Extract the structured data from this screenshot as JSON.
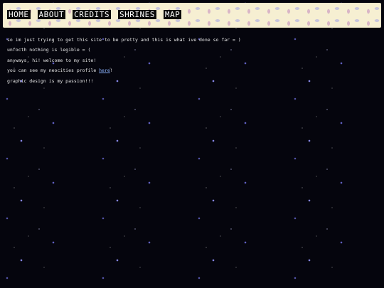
{
  "nav": {
    "items": [
      {
        "label": "HOME"
      },
      {
        "label": "ABOUT"
      },
      {
        "label": "CREDITS"
      },
      {
        "label": "SHRINES"
      },
      {
        "label": "MAP"
      }
    ]
  },
  "content": {
    "line1": "so im just trying to get this site to be pretty and this is what ive done so far = )",
    "line2": "unfocth nothing is legible = (",
    "line3": "anyways, hi! welcome to my site!",
    "line4_before": "you can see my neocities profile ",
    "line4_link": "here",
    "line4_after": "!",
    "line5": "graphic design is my passion!!!"
  },
  "colors": {
    "background": "#05050d",
    "header_background": "#f6efd2",
    "nav_background": "#0a0a0a",
    "link": "#8cb4ff",
    "star": "#7878f0"
  }
}
